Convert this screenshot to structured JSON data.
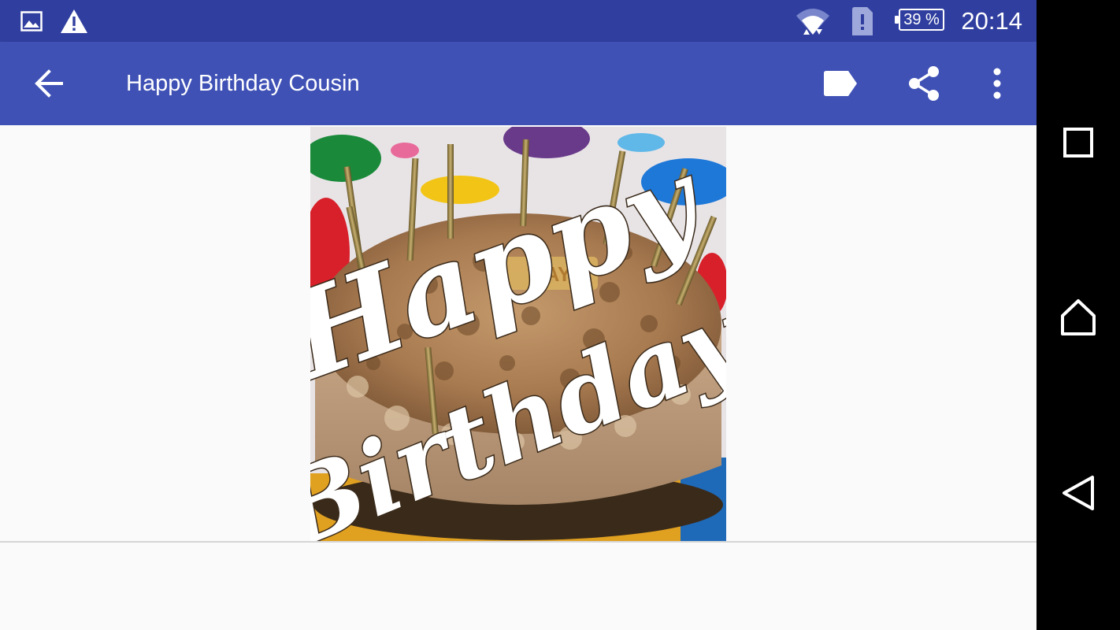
{
  "status_bar": {
    "time": "20:14",
    "battery_percent": "39 %",
    "icons": [
      "gallery-icon",
      "warning-icon",
      "wifi-icon",
      "sim-alert-icon",
      "battery-icon"
    ]
  },
  "toolbar": {
    "title": "Happy Birthday Cousin",
    "icons": [
      "back-arrow-icon",
      "label-tag-icon",
      "share-icon",
      "more-vert-icon"
    ]
  },
  "image": {
    "text_line1": "Happy",
    "text_line2": "Birthday",
    "cake_topper_text": "DAY"
  },
  "nav_bar": {
    "icons": [
      "recents-icon",
      "home-icon",
      "back-icon"
    ]
  },
  "colors": {
    "status_bar": "#303f9f",
    "toolbar": "#3f51b5",
    "background": "#fafafa"
  }
}
